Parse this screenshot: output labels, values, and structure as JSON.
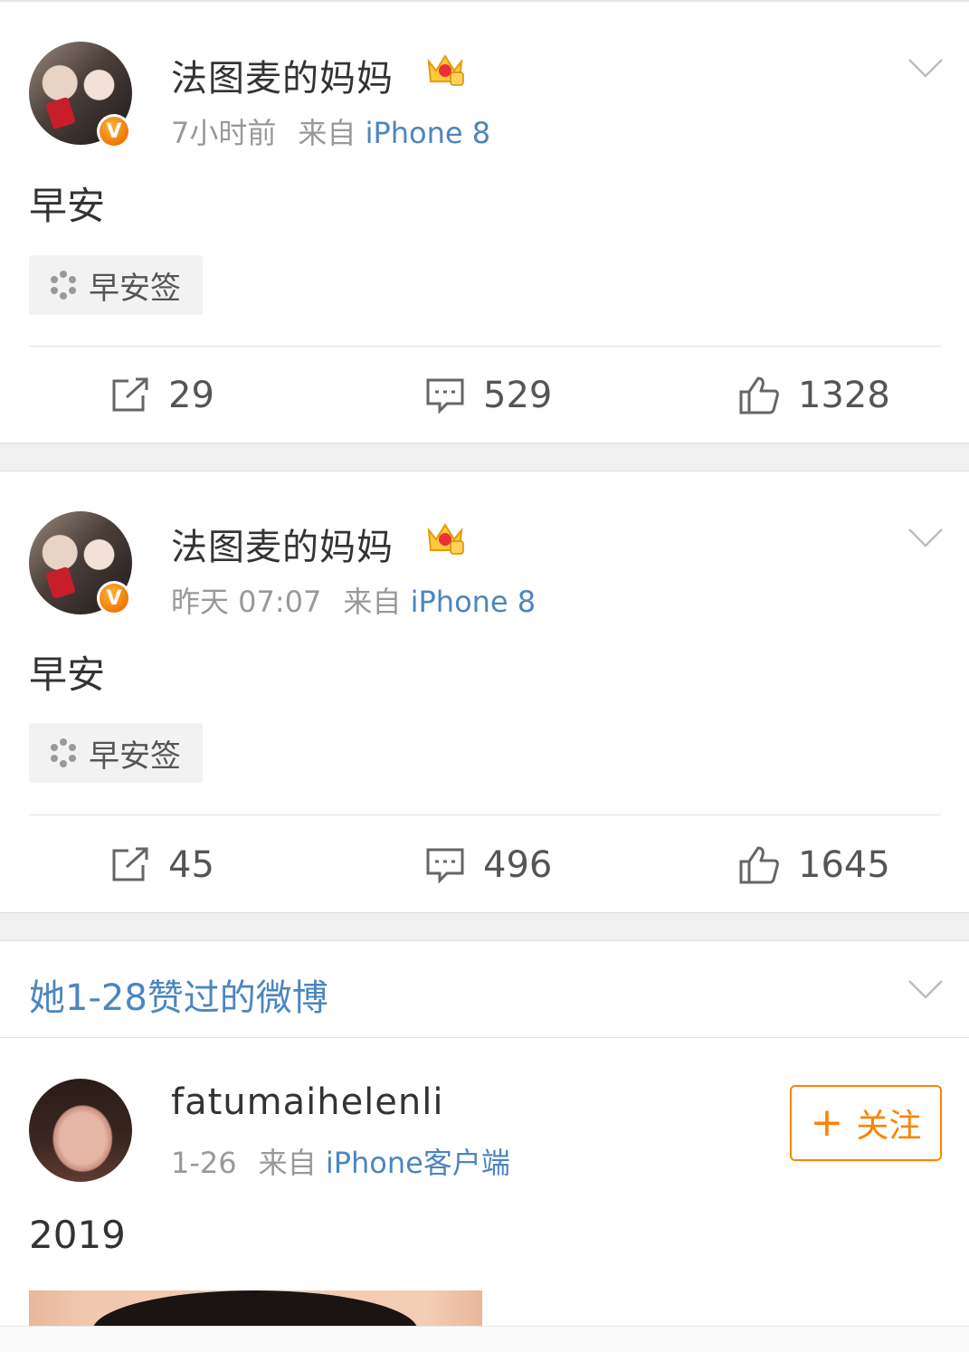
{
  "posts": [
    {
      "username": "法图麦的妈妈",
      "time": "7小时前",
      "source_prefix": "来自",
      "source": "iPhone 8",
      "text": "早安",
      "tag": "早安签",
      "reposts": "29",
      "comments": "529",
      "likes": "1328"
    },
    {
      "username": "法图麦的妈妈",
      "time": "昨天 07:07",
      "source_prefix": "来自",
      "source": "iPhone 8",
      "text": "早安",
      "tag": "早安签",
      "reposts": "45",
      "comments": "496",
      "likes": "1645"
    }
  ],
  "liked_section": {
    "title": "她1-28赞过的微博"
  },
  "liked_post": {
    "username": "fatumaihelenli",
    "time": "1-26",
    "source_prefix": "来自",
    "source": "iPhone客户端",
    "follow_label": "关注",
    "follow_plus": "+",
    "text": "2019"
  },
  "badges": {
    "verified": "V"
  },
  "colors": {
    "link": "#4c86c0",
    "accent": "#ff8200",
    "verified": "#f07800"
  },
  "icons": [
    "crown-icon",
    "chevron-down-icon",
    "repost-icon",
    "comment-icon",
    "like-icon",
    "tag-icon"
  ]
}
